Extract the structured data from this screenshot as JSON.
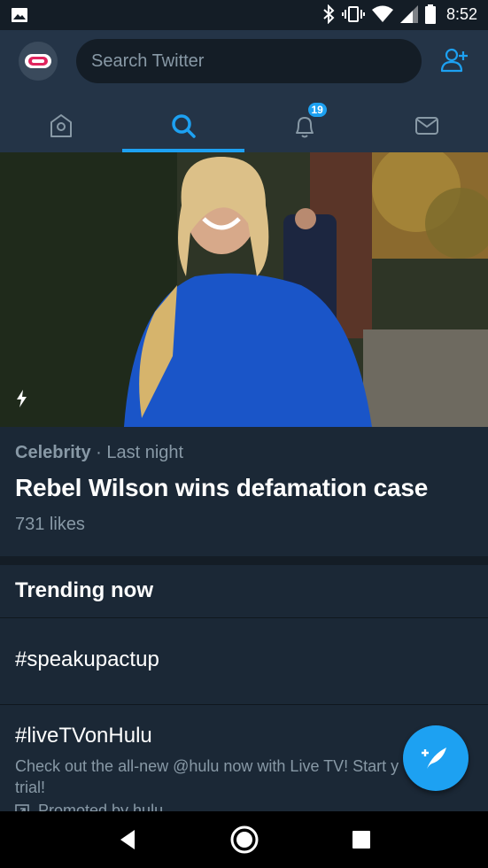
{
  "status_bar": {
    "time": "8:52",
    "icons": [
      "gallery-icon",
      "bluetooth-icon",
      "vibrate-icon",
      "wifi-icon",
      "signal-icon",
      "battery-icon"
    ]
  },
  "header": {
    "search_placeholder": "Search Twitter",
    "tabs": [
      {
        "name": "home-tab",
        "icon": "home-icon",
        "active": false
      },
      {
        "name": "search-tab",
        "icon": "search-icon",
        "active": true
      },
      {
        "name": "notifications-tab",
        "icon": "bell-icon",
        "active": false,
        "badge": "19"
      },
      {
        "name": "messages-tab",
        "icon": "mail-icon",
        "active": false
      }
    ]
  },
  "story": {
    "category": "Celebrity",
    "separator": " · ",
    "time": "Last night",
    "title": "Rebel Wilson wins defamation case",
    "likes": "731 likes"
  },
  "trending": {
    "heading": "Trending now",
    "items": [
      {
        "name": "#speakupactup"
      },
      {
        "name": "#liveTVonHulu",
        "description": "Check out the all-new @hulu now with Live TV! Start y",
        "description_line2": "trial!",
        "promoted": "Promoted by hulu"
      }
    ]
  },
  "colors": {
    "accent": "#1da1f2",
    "header_bg": "#243447",
    "page_bg": "#1b2836",
    "secondary_text": "#8899a6"
  }
}
